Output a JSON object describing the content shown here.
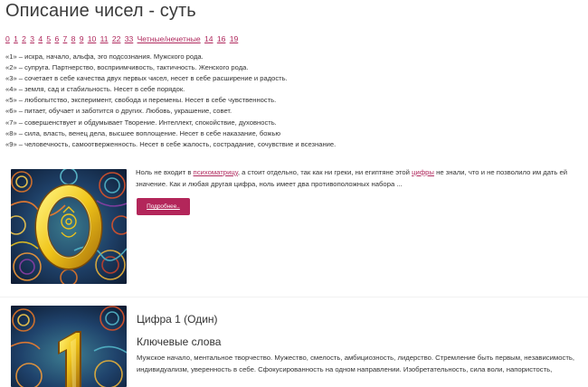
{
  "page": {
    "title": "Описание чисел - суть"
  },
  "number_nav": [
    "0",
    "1",
    "2",
    "3",
    "4",
    "5",
    "6",
    "7",
    "8",
    "9",
    "10",
    "11",
    "22",
    "33",
    "Четные/нечетные",
    "14",
    "16",
    "19"
  ],
  "meanings": [
    "«1» – искра, начало, альфа, эго подсознания. Мужского рода.",
    "«2» – супруга. Партнерство, восприимчивость, тактичность. Женского рода.",
    "«3» – сочетает в себе качества двух первых чисел, несет в себе расширение и радость.",
    "«4» – земля, сад и стабильность. Несет в себе порядок.",
    "«5» – любопытство, эксперимент, свобода и перемены. Несет в себе чувственность.",
    "«6» – питает, обучает и заботится о других. Любовь, украшение, совет.",
    "«7» – совершенствует и обдумывает Творение. Интеллект, спокойствие, духовность.",
    "«8» – сила, власть, венец дела, высшее воплощение. Несет в себе наказание, божью",
    "«9» – человечность, самоотверженность. Несет в себе жалость, сострадание, сочувствие и всезнание."
  ],
  "post_zero": {
    "image_digit": "0",
    "excerpt_part1": "Ноль не входит в ",
    "excerpt_link1": "психоматрицу",
    "excerpt_part2": ", а стоит отдельно, так как ни греки, ни египтяне этой ",
    "excerpt_link2": "цифры",
    "excerpt_part3": " не знали, что и не позволило им дать ей значение. Как и любая другая цифра, ноль имеет два противоположных набора ...",
    "button_label": "Подробнее.."
  },
  "post_one": {
    "image_digit": "1",
    "heading": "Цифра 1 (Один)",
    "keywords_heading": "Ключевые слова",
    "keywords_text": "Мужское начало, ментальное творчество. Мужество, смелость, амбициозность, лидерство. Стремление быть первым, независимость, индивидуализм, уверенность в себе. Сфокусированность на одном направлении. Изобретательность, сила воли, напористость,"
  },
  "colors": {
    "accent": "#b02a5e",
    "button_bg": "#b3265a",
    "gold": "#e8c21e"
  }
}
